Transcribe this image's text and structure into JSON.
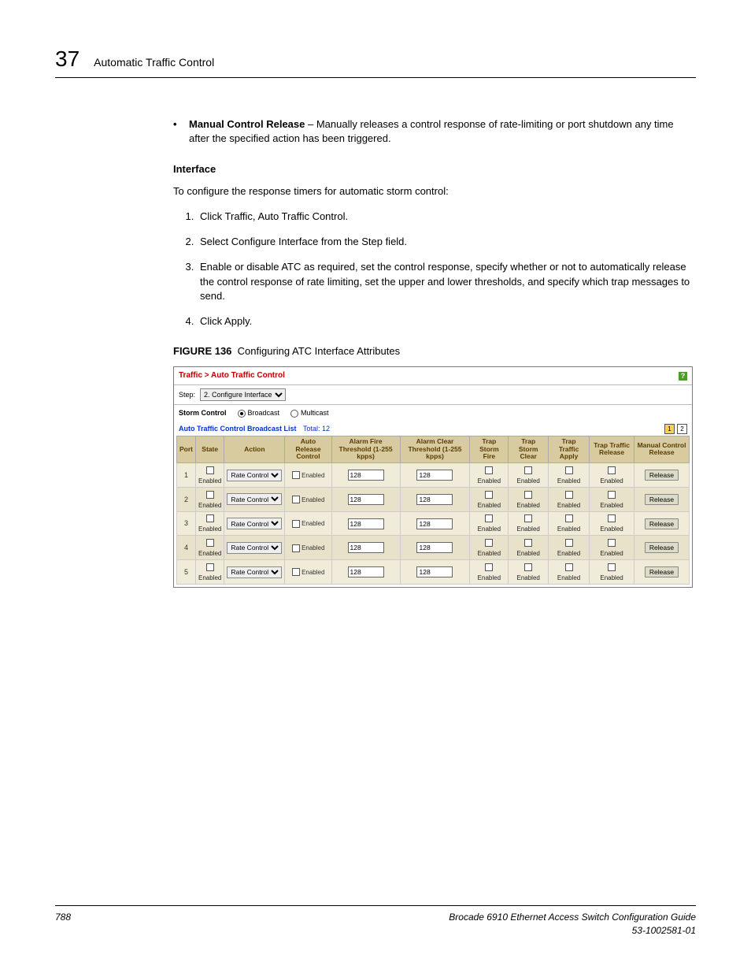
{
  "header": {
    "chapter_num": "37",
    "chapter_title": "Automatic Traffic Control"
  },
  "bullet": {
    "term": "Manual Control Release",
    "text": " – Manually releases a control response of rate-limiting or port shutdown any time after the specified action has been triggered."
  },
  "interface": {
    "title": "Interface",
    "lead": "To configure the response timers for automatic storm control:",
    "steps": [
      "Click Traffic, Auto Traffic Control.",
      "Select Configure Interface from the Step field.",
      "Enable or disable ATC as required, set the control response, specify whether or not to automatically release the control response of rate limiting, set the upper and lower thresholds, and specify which trap messages to send.",
      "Click Apply."
    ]
  },
  "figure": {
    "label": "FIGURE 136",
    "caption": "Configuring ATC Interface Attributes"
  },
  "ui": {
    "breadcrumb": "Traffic > Auto Traffic Control",
    "step_label": "Step:",
    "step_value": "2. Configure Interface",
    "storm_label": "Storm Control",
    "storm_opts": {
      "broadcast": "Broadcast",
      "multicast": "Multicast"
    },
    "list_title": "Auto Traffic Control Broadcast List",
    "list_total": "Total: 12",
    "pagers": [
      "1",
      "2"
    ],
    "headers": {
      "port": "Port",
      "state": "State",
      "action": "Action",
      "arc": "Auto Release Control",
      "fire": "Alarm Fire Threshold (1-255 kpps)",
      "clear": "Alarm Clear Threshold (1-255 kpps)",
      "tsf": "Trap Storm Fire",
      "tsc": "Trap Storm Clear",
      "tta": "Trap Traffic Apply",
      "ttr": "Trap Traffic Release",
      "mcr": "Manual Control Release"
    },
    "enabled": "Enabled",
    "action_val": "Rate Control",
    "release_btn": "Release",
    "rows": [
      {
        "port": "1",
        "fire": "128",
        "clear": "128"
      },
      {
        "port": "2",
        "fire": "128",
        "clear": "128"
      },
      {
        "port": "3",
        "fire": "128",
        "clear": "128"
      },
      {
        "port": "4",
        "fire": "128",
        "clear": "128"
      },
      {
        "port": "5",
        "fire": "128",
        "clear": "128"
      }
    ]
  },
  "footer": {
    "page": "788",
    "guide": "Brocade 6910 Ethernet Access Switch Configuration Guide",
    "docid": "53-1002581-01"
  }
}
